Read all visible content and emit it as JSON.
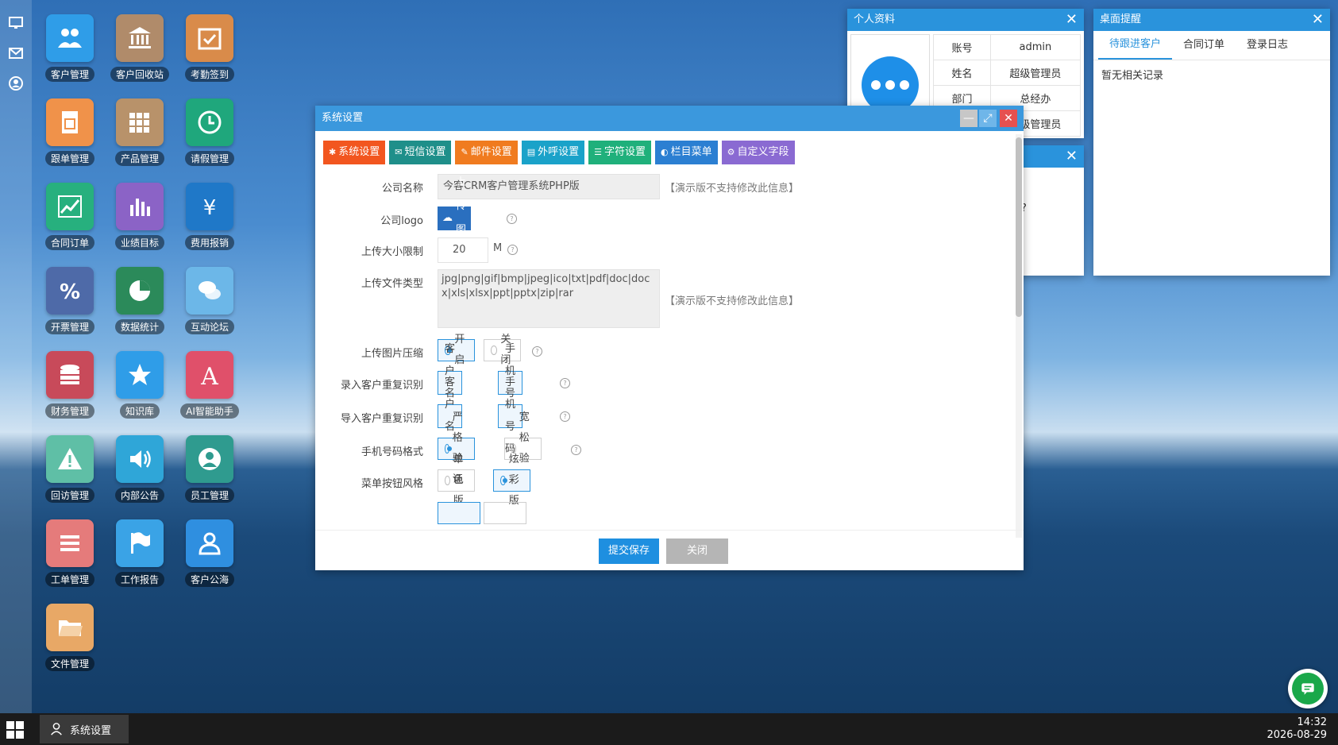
{
  "left_bar": {
    "icons": [
      "monitor-icon",
      "mail-icon",
      "user-icon"
    ]
  },
  "desktop": {
    "icons": [
      {
        "label": "客户管理",
        "icon": "users-icon",
        "color": "#2f9de8"
      },
      {
        "label": "客户回收站",
        "icon": "bank-icon",
        "color": "#b08b6a"
      },
      {
        "label": "考勤签到",
        "icon": "calendar-check-icon",
        "color": "#d98b4a"
      },
      {
        "label": "跟单管理",
        "icon": "invoice-icon",
        "color": "#f0924a"
      },
      {
        "label": "产品管理",
        "icon": "grid-icon",
        "color": "#b8926a"
      },
      {
        "label": "请假管理",
        "icon": "clock-icon",
        "color": "#1fa77c"
      },
      {
        "label": "合同订单",
        "icon": "chart-line-icon",
        "color": "#27b07e"
      },
      {
        "label": "业绩目标",
        "icon": "bar-chart-icon",
        "color": "#8b63c6"
      },
      {
        "label": "费用报销",
        "icon": "yen-icon",
        "color": "#1f78c8"
      },
      {
        "label": "开票管理",
        "icon": "percent-icon",
        "color": "#4e6aa8"
      },
      {
        "label": "数据统计",
        "icon": "pie-chart-icon",
        "color": "#2b8a5a"
      },
      {
        "label": "互动论坛",
        "icon": "chat-bubbles-icon",
        "color": "#6cb7e8"
      },
      {
        "label": "财务管理",
        "icon": "database-icon",
        "color": "#c84a5a"
      },
      {
        "label": "知识库",
        "icon": "star-icon",
        "color": "#2f9de8"
      },
      {
        "label": "AI智能助手",
        "icon": "letter-a-icon",
        "color": "#e0506a"
      },
      {
        "label": "回访管理",
        "icon": "warning-icon",
        "color": "#5fbfa6"
      },
      {
        "label": "内部公告",
        "icon": "speaker-icon",
        "color": "#2fa6d8"
      },
      {
        "label": "员工管理",
        "icon": "user-circle-icon",
        "color": "#2f9b8f"
      },
      {
        "label": "工单管理",
        "icon": "list-icon",
        "color": "#e57b7b"
      },
      {
        "label": "工作报告",
        "icon": "flag-icon",
        "color": "#3aa3e6"
      },
      {
        "label": "客户公海",
        "icon": "user-outline-icon",
        "color": "#2f8fe0"
      },
      {
        "label": "文件管理",
        "icon": "folder-icon",
        "color": "#e8a866"
      }
    ]
  },
  "profile_window": {
    "title": "个人资料",
    "rows": [
      {
        "key": "账号",
        "value": "admin"
      },
      {
        "key": "姓名",
        "value": "超级管理员"
      },
      {
        "key": "部门",
        "value": "总经办"
      },
      {
        "key": "",
        "value": "超级管理员"
      }
    ]
  },
  "remind_window": {
    "title": "桌面提醒",
    "tabs": [
      "待跟进客户",
      "合同订单",
      "登录日志"
    ],
    "active_tab": 0,
    "empty_text": "暂无相关记录"
  },
  "behind_window": {
    "partial_text": "好呢?"
  },
  "settings_window": {
    "title": "系统设置",
    "toolbar": [
      {
        "label": "系统设置",
        "icon": "gear-icon",
        "color": "#f2561f"
      },
      {
        "label": "短信设置",
        "icon": "envelope-icon",
        "color": "#1f8f8a"
      },
      {
        "label": "邮件设置",
        "icon": "edit-icon",
        "color": "#f07b1f"
      },
      {
        "label": "外呼设置",
        "icon": "phone-icon",
        "color": "#1aa2c9"
      },
      {
        "label": "字符设置",
        "icon": "lines-icon",
        "color": "#1fb07b"
      },
      {
        "label": "栏目菜单",
        "icon": "toggle-icon",
        "color": "#2b7fd2"
      },
      {
        "label": "自定义字段",
        "icon": "cogs-icon",
        "color": "#8a6ad2"
      }
    ],
    "form": {
      "company_name": {
        "label": "公司名称",
        "value": "今客CRM客户管理系统PHP版",
        "hint": "【演示版不支持修改此信息】"
      },
      "company_logo": {
        "label": "公司logo",
        "button": "上传图片"
      },
      "upload_size": {
        "label": "上传大小限制",
        "value": "20",
        "unit": "M"
      },
      "upload_types": {
        "label": "上传文件类型",
        "value": "jpg|png|gif|bmp|jpeg|ico|txt|pdf|doc|docx|xls|xlsx|ppt|pptx|zip|rar",
        "hint": "【演示版不支持修改此信息】"
      },
      "image_compress": {
        "label": "上传图片压缩",
        "options": [
          "开启",
          "关闭"
        ],
        "selected": 0
      },
      "entry_dup_check": {
        "label": "录入客户重复识别",
        "options": [
          "客户名称",
          "手机号码"
        ]
      },
      "import_dup_check": {
        "label": "导入客户重复识别",
        "options": [
          "客户名称",
          "手机号码"
        ]
      },
      "phone_format": {
        "label": "手机号码格式",
        "options": [
          "严格验证",
          "宽松验证"
        ],
        "selected": 0
      },
      "menu_style": {
        "label": "菜单按钮风格",
        "options": [
          "单色版",
          "炫彩版"
        ],
        "selected": 1
      }
    },
    "footer": {
      "submit": "提交保存",
      "close": "关闭"
    }
  },
  "taskbar": {
    "task_label": "系统设置",
    "time": "14:32",
    "date": "2026-08-29"
  }
}
